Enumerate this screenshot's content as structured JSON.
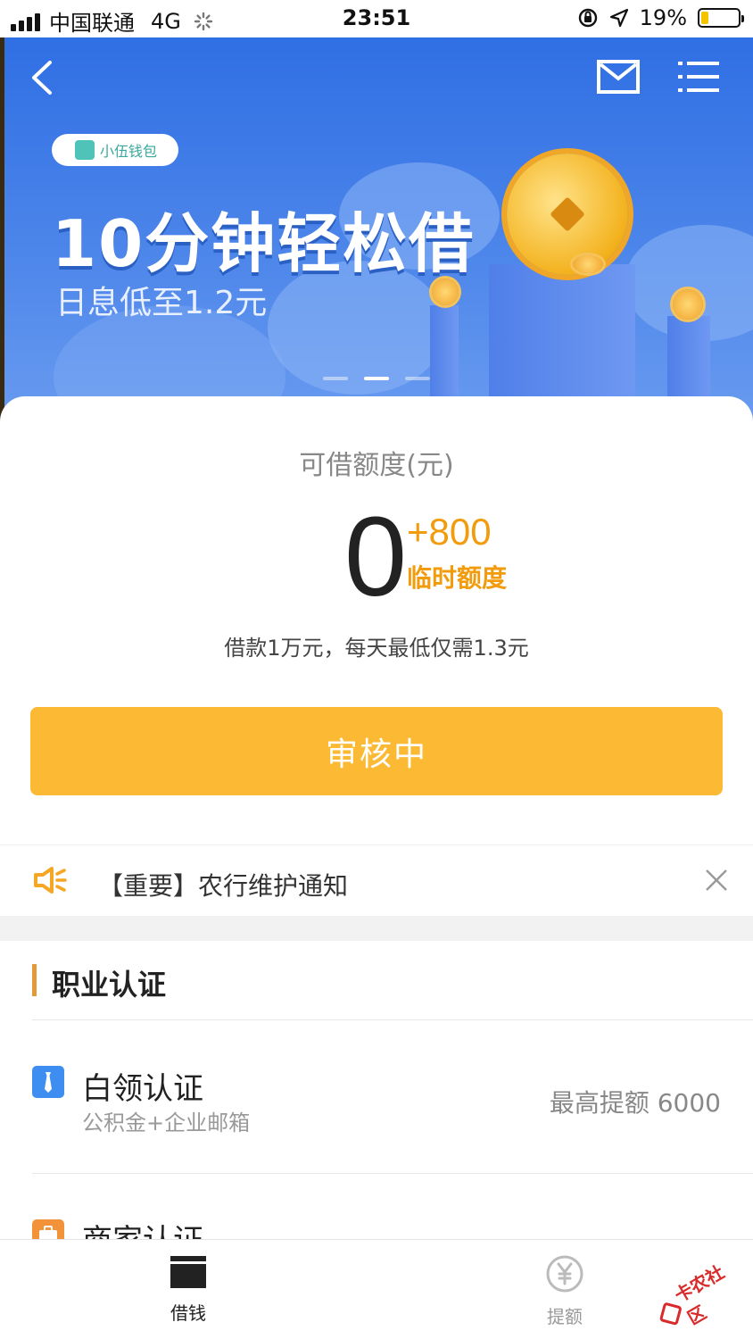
{
  "status_bar": {
    "carrier": "中国联通",
    "network": "4G",
    "time": "23:51",
    "battery": "19%",
    "battery_level": 0.19,
    "battery_color": "#f5c400"
  },
  "banner": {
    "brand": "小伍钱包",
    "headline": "10分钟轻松借",
    "subline": "日息低至1.2元",
    "icons": [
      "back-arrow-icon",
      "mail-icon",
      "menu-icon"
    ],
    "slides_total": 3,
    "active_slide": 2
  },
  "credit": {
    "label": "可借额度(元)",
    "amount": "0",
    "temp_amount": "+800",
    "temp_label": "临时额度",
    "promo": "借款1万元，每天最低仅需1.3元",
    "button": "审核中",
    "accent_color": "#f29b0c",
    "button_color": "#fbb934"
  },
  "notice": {
    "text": "【重要】农行维护通知",
    "icons": [
      "speaker-icon",
      "close-icon"
    ]
  },
  "career": {
    "title": "职业认证",
    "items": [
      {
        "title": "白领认证",
        "subtitle": "公积金+企业邮箱",
        "limit": "最高提额 6000",
        "icon": "tie-icon",
        "color": "#3d8ef0"
      },
      {
        "title": "商家认证",
        "icon": "briefcase-icon",
        "color": "#f2933a"
      }
    ]
  },
  "tabs": [
    {
      "label": "借钱",
      "icon": "wallet-icon",
      "active": true
    },
    {
      "label": "提额",
      "icon": "yuan-circle-icon",
      "active": false
    }
  ],
  "watermark": "卡农社区"
}
